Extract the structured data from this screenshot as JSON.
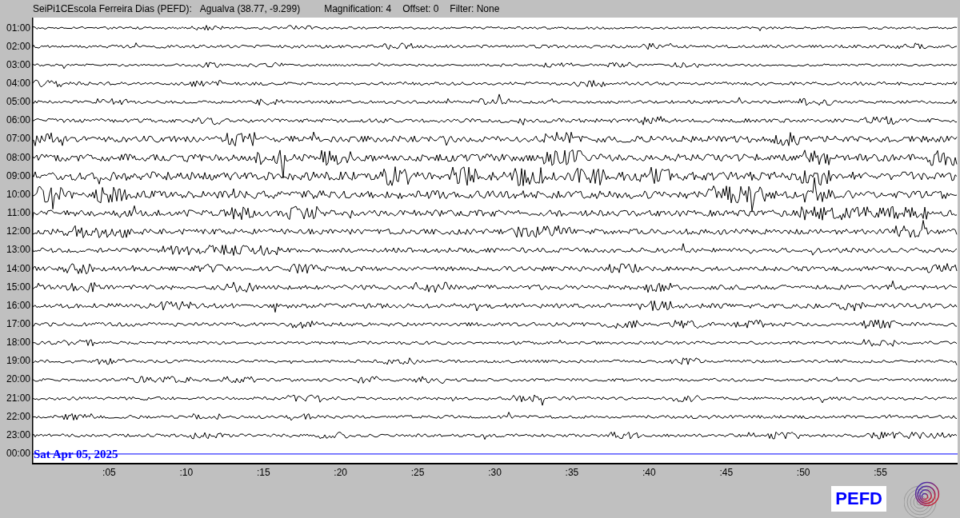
{
  "header": [
    "SeiPi1CEscola Ferreira Dias (PEFD):",
    "Agualva (38.77, -9.299)",
    "Magnification: 4",
    "Offset: 0",
    "Filter: None"
  ],
  "rows": [
    {
      "label": "01:00",
      "kind": "trace"
    },
    {
      "label": "02:00",
      "kind": "trace"
    },
    {
      "label": "03:00",
      "kind": "trace"
    },
    {
      "label": "04:00",
      "kind": "trace"
    },
    {
      "label": "05:00",
      "kind": "trace"
    },
    {
      "label": "06:00",
      "kind": "trace"
    },
    {
      "label": "07:00",
      "kind": "trace"
    },
    {
      "label": "08:00",
      "kind": "trace"
    },
    {
      "label": "09:00",
      "kind": "trace"
    },
    {
      "label": "10:00",
      "kind": "trace"
    },
    {
      "label": "11:00",
      "kind": "trace"
    },
    {
      "label": "12:00",
      "kind": "trace"
    },
    {
      "label": "13:00",
      "kind": "trace"
    },
    {
      "label": "14:00",
      "kind": "trace"
    },
    {
      "label": "15:00",
      "kind": "trace"
    },
    {
      "label": "16:00",
      "kind": "trace"
    },
    {
      "label": "17:00",
      "kind": "trace"
    },
    {
      "label": "18:00",
      "kind": "trace"
    },
    {
      "label": "19:00",
      "kind": "trace"
    },
    {
      "label": "20:00",
      "kind": "trace"
    },
    {
      "label": "21:00",
      "kind": "trace"
    },
    {
      "label": "22:00",
      "kind": "trace"
    },
    {
      "label": "23:00",
      "kind": "trace"
    },
    {
      "label": "00:00",
      "kind": "current",
      "date": "Sat Apr 05, 2025"
    }
  ],
  "x_ticks": [
    ":05",
    ":10",
    ":15",
    ":20",
    ":25",
    ":30",
    ":35",
    ":40",
    ":45",
    ":50",
    ":55"
  ],
  "station_badge": "PEFD"
}
